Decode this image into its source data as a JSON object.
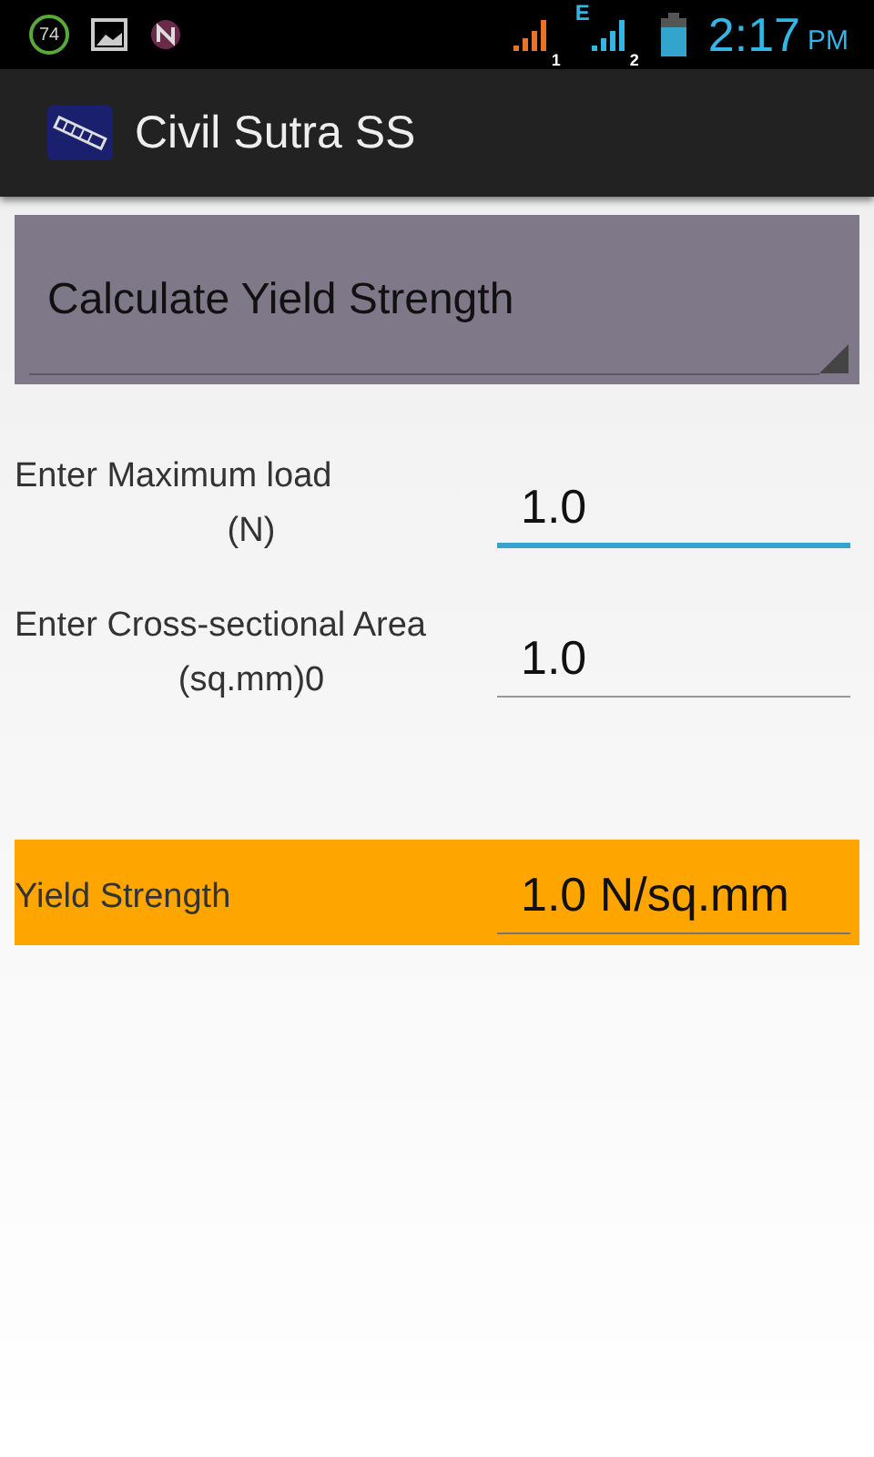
{
  "status_bar": {
    "badge": "74",
    "network_type": "E",
    "sim_1": "1",
    "sim_2": "2",
    "time": "2:17",
    "meridiem": "PM"
  },
  "app_bar": {
    "title": "Civil Sutra SS"
  },
  "spinner": {
    "value": "Calculate Yield Strength"
  },
  "inputs": [
    {
      "label_line_1": "Enter Maximum load",
      "label_line_2": "(N)",
      "value": "1.0",
      "focused": true
    },
    {
      "label_line_1": "Enter Cross-sectional Area",
      "label_line_2": "(sq.mm)0",
      "value": "1.0",
      "focused": false
    }
  ],
  "result": {
    "label": "Yield Strength",
    "value": "1.0 N/sq.mm"
  }
}
